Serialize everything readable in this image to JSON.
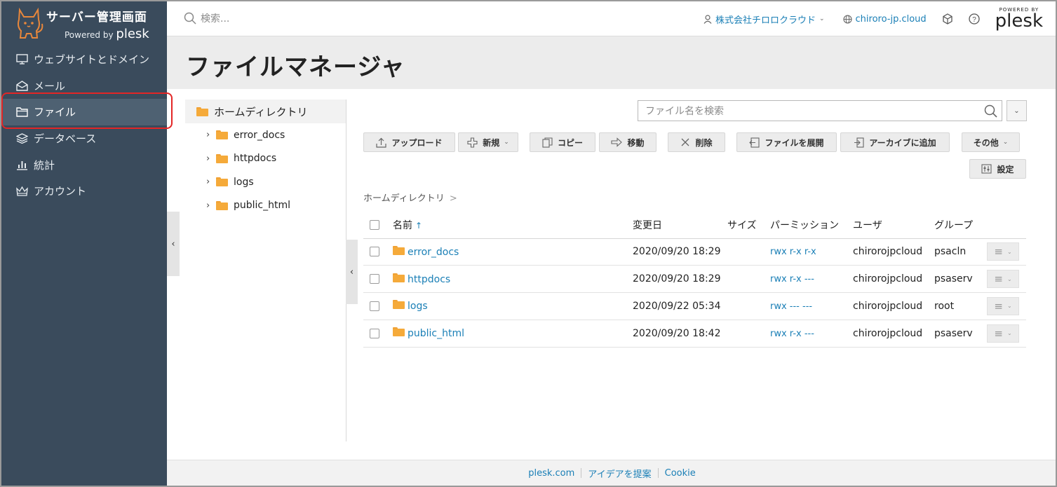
{
  "sidebar": {
    "brand_title": "サーバー管理画面",
    "brand_powered": "Powered by",
    "brand_plesk": "plesk",
    "items": [
      {
        "label": "ウェブサイトとドメイン",
        "icon": "monitor-icon"
      },
      {
        "label": "メール",
        "icon": "mail-icon"
      },
      {
        "label": "ファイル",
        "icon": "folder-icon",
        "active": true
      },
      {
        "label": "データベース",
        "icon": "database-icon"
      },
      {
        "label": "統計",
        "icon": "chart-icon"
      },
      {
        "label": "アカウント",
        "icon": "crown-icon"
      }
    ],
    "toggle_glyph": "‹"
  },
  "topbar": {
    "search_placeholder": "検索...",
    "account_label": "株式会社チロロクラウド",
    "domain_label": "chiroro-jp.cloud",
    "logo_powered": "POWERED BY",
    "logo_plesk": "plesk"
  },
  "page": {
    "title": "ファイルマネージャ"
  },
  "tree": {
    "root_label": "ホームディレクトリ",
    "items": [
      "error_docs",
      "httpdocs",
      "logs",
      "public_html"
    ],
    "toggle_glyph": "‹"
  },
  "toolbar": {
    "file_search_placeholder": "ファイル名を検索",
    "upload": "アップロード",
    "new": "新規",
    "copy": "コピー",
    "move": "移動",
    "delete": "削除",
    "extract": "ファイルを展開",
    "archive": "アーカイブに追加",
    "more": "その他",
    "settings": "設定"
  },
  "breadcrumb": "ホームディレクトリ",
  "breadcrumb_sep": ">",
  "table": {
    "headers": {
      "name": "名前",
      "modified": "変更日",
      "size": "サイズ",
      "permission": "パーミッション",
      "user": "ユーザ",
      "group": "グループ"
    },
    "rows": [
      {
        "name": "error_docs",
        "modified": "2020/09/20 18:29",
        "size": "",
        "permission": "rwx r-x r-x",
        "user": "chirorojpcloud",
        "group": "psacln"
      },
      {
        "name": "httpdocs",
        "modified": "2020/09/20 18:29",
        "size": "",
        "permission": "rwx r-x ---",
        "user": "chirorojpcloud",
        "group": "psaserv"
      },
      {
        "name": "logs",
        "modified": "2020/09/22 05:34",
        "size": "",
        "permission": "rwx --- ---",
        "user": "chirorojpcloud",
        "group": "root"
      },
      {
        "name": "public_html",
        "modified": "2020/09/20 18:42",
        "size": "",
        "permission": "rwx r-x ---",
        "user": "chirorojpcloud",
        "group": "psaserv"
      }
    ]
  },
  "footer": {
    "links": [
      "plesk.com",
      "アイデアを提案",
      "Cookie"
    ]
  },
  "colors": {
    "sidebar_bg": "#3a4b5c",
    "link": "#1a7fb6",
    "folder": "#f5aa3a",
    "highlight": "#e32626"
  }
}
